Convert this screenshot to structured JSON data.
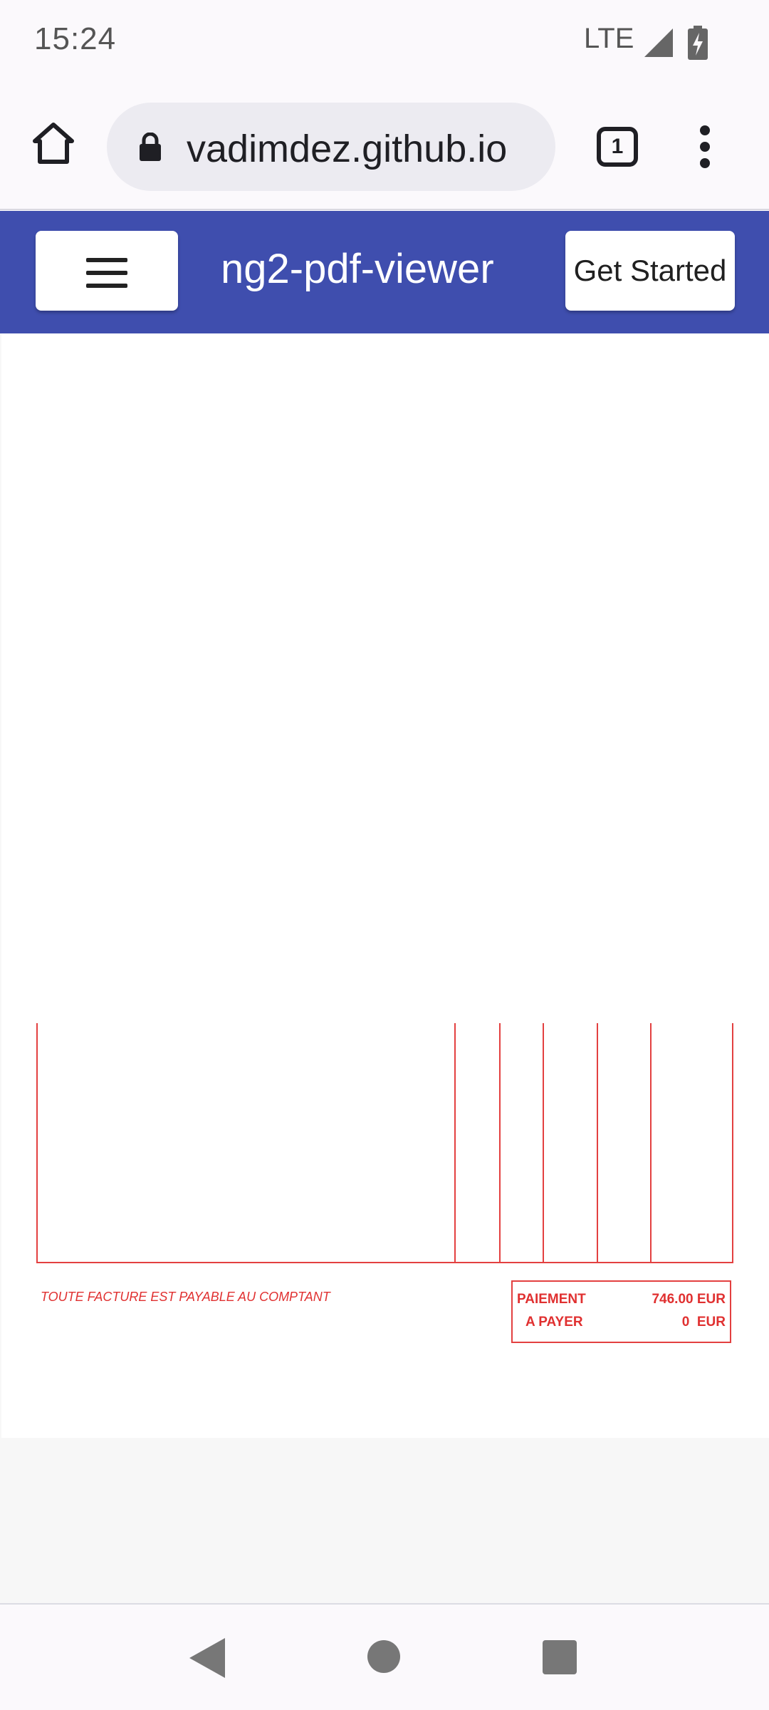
{
  "status_bar": {
    "time": "15:24",
    "network": "LTE",
    "icons": [
      "signal-icon",
      "battery-charging-icon"
    ]
  },
  "browser": {
    "url": "vadimdez.github.io",
    "tab_count": "1",
    "icons": [
      "home-icon",
      "lock-icon",
      "tabs-icon",
      "overflow-menu-icon"
    ]
  },
  "toolbar": {
    "title": "ng2-pdf-viewer",
    "get_started_label": "Get Started",
    "background_color": "#3f4eae",
    "icons": [
      "menu-icon"
    ]
  },
  "pdf": {
    "footer_note": "TOUTE FACTURE EST PAYABLE AU COMPTANT",
    "payment": {
      "paid_label": "PAIEMENT",
      "paid_value": "746.00 EUR",
      "due_label": "A PAYER",
      "due_value": "0  EUR"
    },
    "line_color": "#e34040"
  },
  "nav_bar": {
    "icons": [
      "back-icon",
      "home-icon",
      "recents-icon"
    ]
  }
}
